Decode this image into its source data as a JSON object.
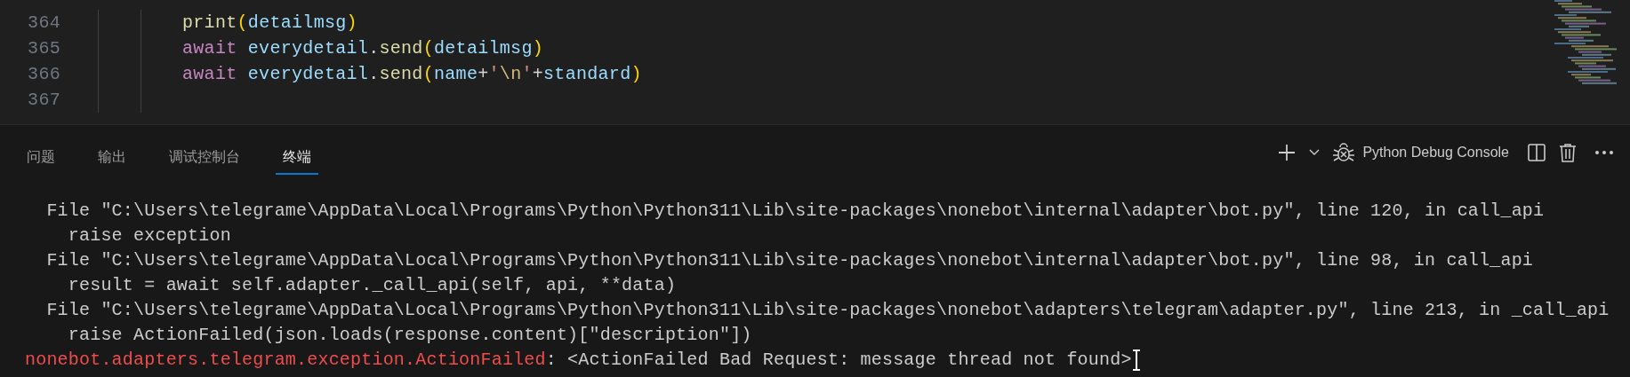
{
  "editor": {
    "lines": [
      {
        "number": "364",
        "tokens": [
          {
            "text": "print",
            "kind": "function"
          },
          {
            "text": "(",
            "kind": "bracket"
          },
          {
            "text": "detailmsg",
            "kind": "variable"
          },
          {
            "text": ")",
            "kind": "bracket"
          }
        ]
      },
      {
        "number": "365",
        "tokens": [
          {
            "text": "await ",
            "kind": "keyword"
          },
          {
            "text": "everydetail",
            "kind": "variable"
          },
          {
            "text": ".",
            "kind": "plain"
          },
          {
            "text": "send",
            "kind": "function"
          },
          {
            "text": "(",
            "kind": "bracket"
          },
          {
            "text": "detailmsg",
            "kind": "variable"
          },
          {
            "text": ")",
            "kind": "bracket"
          }
        ]
      },
      {
        "number": "366",
        "tokens": [
          {
            "text": "await ",
            "kind": "keyword"
          },
          {
            "text": "everydetail",
            "kind": "variable"
          },
          {
            "text": ".",
            "kind": "plain"
          },
          {
            "text": "send",
            "kind": "function"
          },
          {
            "text": "(",
            "kind": "bracket"
          },
          {
            "text": "name",
            "kind": "variable"
          },
          {
            "text": "+",
            "kind": "plain"
          },
          {
            "text": "'",
            "kind": "string"
          },
          {
            "text": "\\n",
            "kind": "escape"
          },
          {
            "text": "'",
            "kind": "string"
          },
          {
            "text": "+",
            "kind": "plain"
          },
          {
            "text": "standard",
            "kind": "variable"
          },
          {
            "text": ")",
            "kind": "bracket"
          }
        ]
      },
      {
        "number": "367"
      }
    ]
  },
  "panel": {
    "tabs": [
      {
        "label": "问题",
        "selected": false
      },
      {
        "label": "输出",
        "selected": false
      },
      {
        "label": "调试控制台",
        "selected": false
      },
      {
        "label": "终端",
        "selected": true
      }
    ],
    "terminal_name": "Python Debug Console",
    "terminal": [
      {
        "segments": [
          {
            "text": "  File \"C:\\Users\\telegrame\\AppData\\Local\\Programs\\Python\\Python311\\Lib\\site-packages\\nonebot\\internal\\adapter\\bot.py\", line 120, in call_api",
            "kind": "normal"
          }
        ]
      },
      {
        "segments": [
          {
            "text": "    raise exception",
            "kind": "normal"
          }
        ]
      },
      {
        "segments": [
          {
            "text": "  File \"C:\\Users\\telegrame\\AppData\\Local\\Programs\\Python\\Python311\\Lib\\site-packages\\nonebot\\internal\\adapter\\bot.py\", line 98, in call_api",
            "kind": "normal"
          }
        ]
      },
      {
        "segments": [
          {
            "text": "    result = await self.adapter._call_api(self, api, **data)",
            "kind": "normal"
          }
        ]
      },
      {
        "segments": [
          {
            "text": "  File \"C:\\Users\\telegrame\\AppData\\Local\\Programs\\Python\\Python311\\Lib\\site-packages\\nonebot\\adapters\\telegram\\adapter.py\", line 213, in _call_api",
            "kind": "normal"
          }
        ]
      },
      {
        "segments": [
          {
            "text": "    raise ActionFailed(json.loads(response.content)[\"description\"])",
            "kind": "normal"
          }
        ]
      },
      {
        "segments": [
          {
            "text": "nonebot.adapters.telegram.exception.ActionFailed",
            "kind": "error"
          },
          {
            "text": ": <ActionFailed Bad Request: message thread not found>",
            "kind": "normal"
          }
        ],
        "cursor": true
      }
    ]
  }
}
